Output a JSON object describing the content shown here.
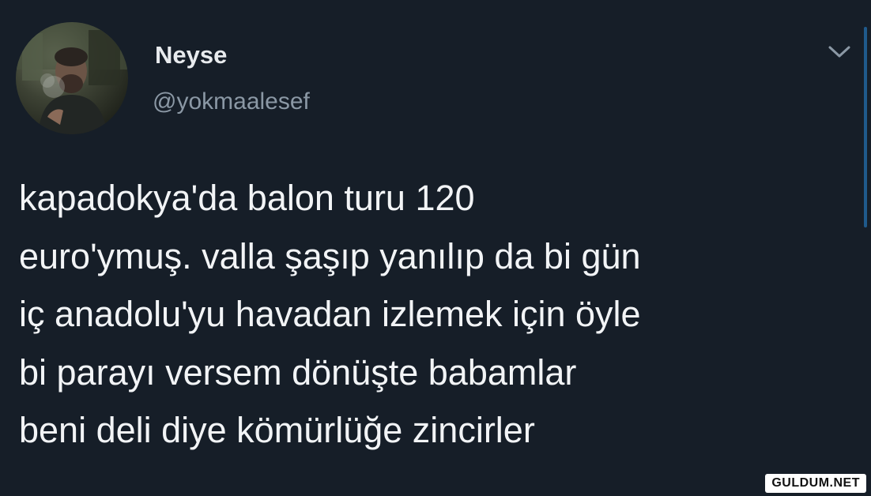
{
  "tweet": {
    "display_name": "Neyse",
    "handle": "@yokmaalesef",
    "text_lines": [
      "kapadokya'da balon turu 120",
      "euro'ymuş. valla şaşıp yanılıp da bi gün",
      "iç anadolu'yu havadan izlemek için öyle",
      "bi parayı versem dönüşte babamlar",
      "beni deli diye kömürlüğe zincirler"
    ],
    "menu_icon": "chevron-down-icon",
    "avatar_icon": "profile-photo"
  },
  "watermark": {
    "text": "GULDUM.NET"
  },
  "colors": {
    "background": "#161e28",
    "text_primary": "#f2f4f6",
    "text_secondary": "#8b98a5",
    "accent": "#1f5a8c"
  }
}
